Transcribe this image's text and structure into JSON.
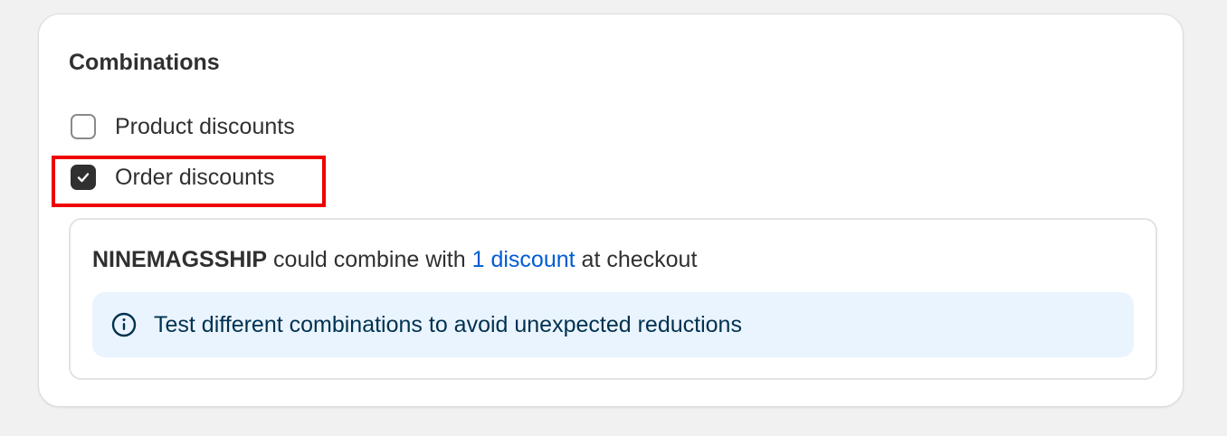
{
  "card": {
    "title": "Combinations"
  },
  "options": [
    {
      "label": "Product discounts",
      "checked": false
    },
    {
      "label": "Order discounts",
      "checked": true
    }
  ],
  "summary": {
    "code": "NINEMAGSSHIP",
    "middle": "could combine with",
    "link": "1 discount",
    "end": "at checkout"
  },
  "banner": {
    "icon": "info-icon",
    "text": "Test different combinations to avoid unexpected reductions"
  },
  "colors": {
    "highlight": "#ee0000",
    "link": "#005bd3",
    "banner_bg": "#eaf4ff",
    "checkbox_checked": "#303030"
  }
}
